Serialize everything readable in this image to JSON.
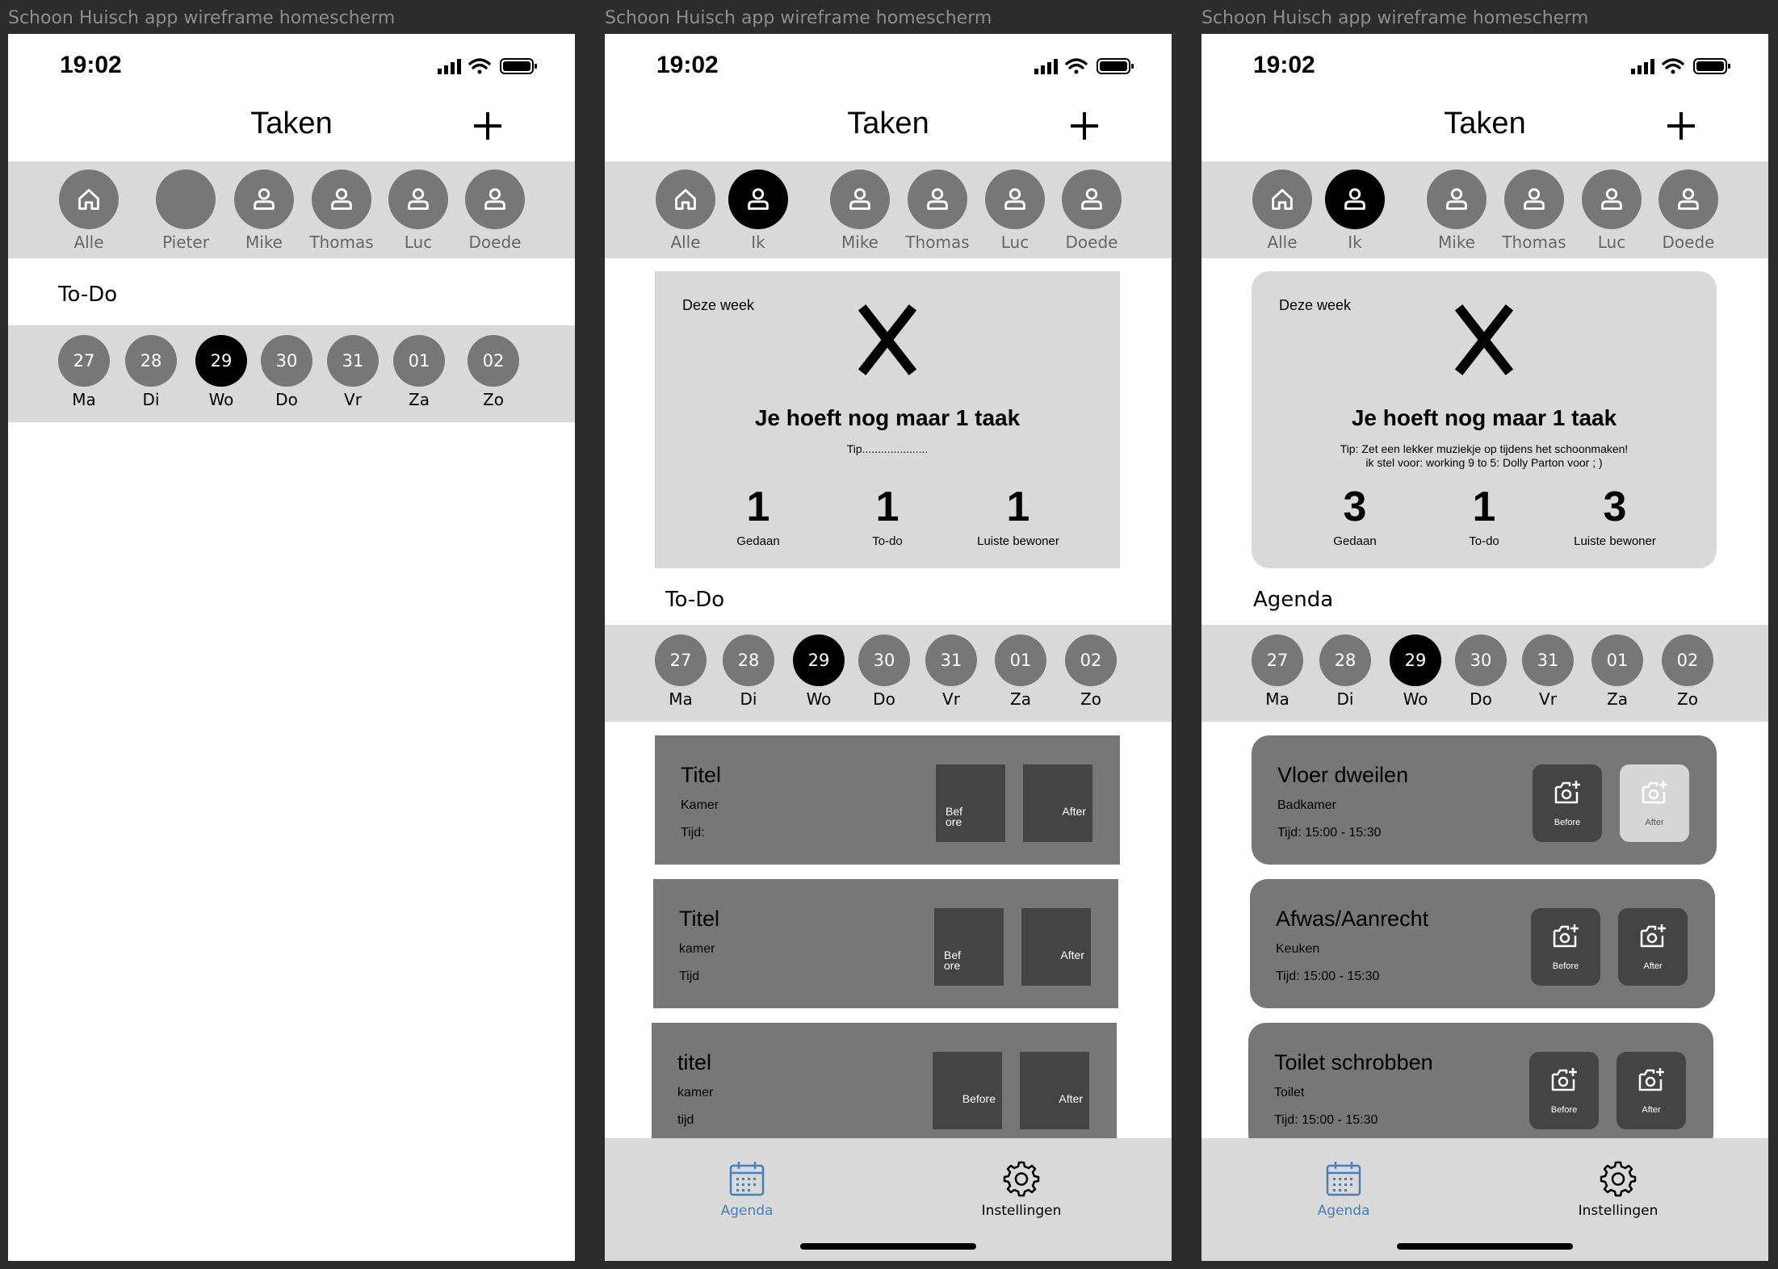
{
  "frame_titles": [
    "Schoon Huisch app wireframe homescherm",
    "Schoon Huisch app wireframe homescherm",
    "Schoon Huisch app wireframe homescherm"
  ],
  "colors": {
    "background": "#2c2c2c",
    "band": "#d9d9d9",
    "chip": "#777777",
    "selected": "#000000",
    "tab_active": "#4a7fb5"
  },
  "screens": [
    {
      "status_time": "19:02",
      "header_title": "Taken",
      "people": [
        {
          "label": "Alle",
          "icon": "home-icon",
          "selected": false
        },
        {
          "label": "Pieter",
          "icon": "none",
          "selected": false
        },
        {
          "label": "Mike",
          "icon": "person-icon",
          "selected": false
        },
        {
          "label": "Thomas",
          "icon": "person-icon",
          "selected": false
        },
        {
          "label": "Luc",
          "icon": "person-icon",
          "selected": false
        },
        {
          "label": "Doede",
          "icon": "person-icon",
          "selected": false
        }
      ],
      "section_label": "To-Do",
      "days": [
        {
          "num": "27",
          "name": "Ma"
        },
        {
          "num": "28",
          "name": "Di"
        },
        {
          "num": "29",
          "name": "Wo",
          "selected": true
        },
        {
          "num": "30",
          "name": "Do"
        },
        {
          "num": "31",
          "name": "Vr"
        },
        {
          "num": "01",
          "name": "Za"
        },
        {
          "num": "02",
          "name": "Zo"
        }
      ]
    },
    {
      "status_time": "19:02",
      "header_title": "Taken",
      "people": [
        {
          "label": "Alle",
          "icon": "home-icon",
          "selected": false
        },
        {
          "label": "Ik",
          "icon": "person-icon",
          "selected": true
        },
        {
          "label": "Mike",
          "icon": "person-icon",
          "selected": false
        },
        {
          "label": "Thomas",
          "icon": "person-icon",
          "selected": false
        },
        {
          "label": "Luc",
          "icon": "person-icon",
          "selected": false
        },
        {
          "label": "Doede",
          "icon": "person-icon",
          "selected": false
        }
      ],
      "summary": {
        "week_label": "Deze week",
        "headline": "Je hoeft nog maar 1 taak",
        "tip": "Tip.....................",
        "stats": [
          {
            "value": "1",
            "label": "Gedaan"
          },
          {
            "value": "1",
            "label": "To-do"
          },
          {
            "value": "1",
            "label": "Luiste bewoner"
          }
        ]
      },
      "section_label": "To-Do",
      "days": [
        {
          "num": "27",
          "name": "Ma"
        },
        {
          "num": "28",
          "name": "Di"
        },
        {
          "num": "29",
          "name": "Wo",
          "selected": true
        },
        {
          "num": "30",
          "name": "Do"
        },
        {
          "num": "31",
          "name": "Vr"
        },
        {
          "num": "01",
          "name": "Za"
        },
        {
          "num": "02",
          "name": "Zo"
        }
      ],
      "tasks": [
        {
          "title": "Titel",
          "room": "Kamer",
          "time": "Tijd:",
          "before": "Bef\nore",
          "after": "After"
        },
        {
          "title": "Titel",
          "room": "kamer",
          "time": "Tijd",
          "before": "Bef\nore",
          "after": "After"
        },
        {
          "title": "titel",
          "room": "kamer",
          "time": "tijd",
          "before": "Before",
          "after": "After"
        }
      ],
      "tabs": [
        {
          "label": "Agenda",
          "icon": "calendar-icon",
          "active": true
        },
        {
          "label": "Instellingen",
          "icon": "gear-icon",
          "active": false
        }
      ]
    },
    {
      "status_time": "19:02",
      "header_title": "Taken",
      "people": [
        {
          "label": "Alle",
          "icon": "home-icon",
          "selected": false
        },
        {
          "label": "Ik",
          "icon": "person-icon",
          "selected": true
        },
        {
          "label": "Mike",
          "icon": "person-icon",
          "selected": false
        },
        {
          "label": "Thomas",
          "icon": "person-icon",
          "selected": false
        },
        {
          "label": "Luc",
          "icon": "person-icon",
          "selected": false
        },
        {
          "label": "Doede",
          "icon": "person-icon",
          "selected": false
        }
      ],
      "summary": {
        "week_label": "Deze week",
        "headline": "Je hoeft nog maar 1 taak",
        "tip": "Tip: Zet een lekker muziekje op tijdens het schoonmaken!\nik stel voor: working 9 to 5: Dolly Parton voor ; )",
        "stats": [
          {
            "value": "3",
            "label": "Gedaan"
          },
          {
            "value": "1",
            "label": "To-do"
          },
          {
            "value": "3",
            "label": "Luiste bewoner"
          }
        ]
      },
      "section_label": "Agenda",
      "days": [
        {
          "num": "27",
          "name": "Ma"
        },
        {
          "num": "28",
          "name": "Di"
        },
        {
          "num": "29",
          "name": "Wo",
          "selected": true
        },
        {
          "num": "30",
          "name": "Do"
        },
        {
          "num": "31",
          "name": "Vr"
        },
        {
          "num": "01",
          "name": "Za"
        },
        {
          "num": "02",
          "name": "Zo"
        }
      ],
      "tasks": [
        {
          "title": "Vloer dweilen",
          "room": "Badkamer",
          "time": "Tijd:  15:00 - 15:30",
          "before": "Before",
          "after": "After",
          "after_done": true
        },
        {
          "title": "Afwas/Aanrecht",
          "room": "Keuken",
          "time": "Tijd:  15:00 - 15:30",
          "before": "Before",
          "after": "After"
        },
        {
          "title": "Toilet schrobben",
          "room": "Toilet",
          "time": "Tijd:  15:00 - 15:30",
          "before": "Before",
          "after": "After"
        }
      ],
      "tabs": [
        {
          "label": "Agenda",
          "icon": "calendar-icon",
          "active": true
        },
        {
          "label": "Instellingen",
          "icon": "gear-icon",
          "active": false
        }
      ]
    }
  ]
}
